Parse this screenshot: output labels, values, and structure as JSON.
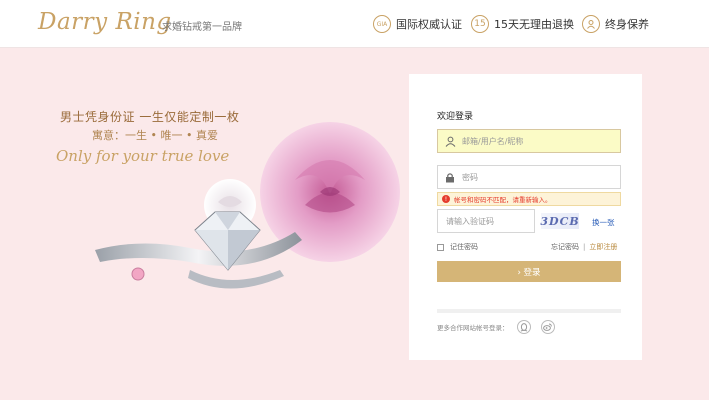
{
  "header": {
    "logo": "Darry Ring",
    "tagline": "求婚钻戒第一品牌",
    "features": [
      {
        "icon": "gia-icon",
        "icon_text": "GIA",
        "label": "国际权威认证"
      },
      {
        "icon": "15-days-icon",
        "icon_text": "15",
        "label": "15天无理由退换"
      },
      {
        "icon": "lifetime-care-icon",
        "icon_text": "",
        "label": "终身保养"
      }
    ]
  },
  "hero": {
    "slogan_line1": "男士凭身份证 一生仅能定制一枚",
    "slogan_line2": "寓意：一生 • 唯一 • 真爱",
    "slogan_line3": "Only for your true love"
  },
  "login": {
    "title": "欢迎登录",
    "username_placeholder": "邮箱/用户名/昵称",
    "password_placeholder": "密码",
    "error_message": "帐号和密码不匹配，请重新输入。",
    "captcha_placeholder": "请输入验证码",
    "captcha_text": "3DCB",
    "refresh_label": "换一张",
    "remember_label": "记住密码",
    "forgot_label": "忘记密码",
    "separator": "|",
    "register_label": "立即注册",
    "submit_label": "› 登录",
    "social_label": "更多合作网站帐号登录："
  },
  "colors": {
    "gold": "#c9a265",
    "button": "#d5b577",
    "background": "#fbe9ea",
    "error": "#e53b2c"
  }
}
